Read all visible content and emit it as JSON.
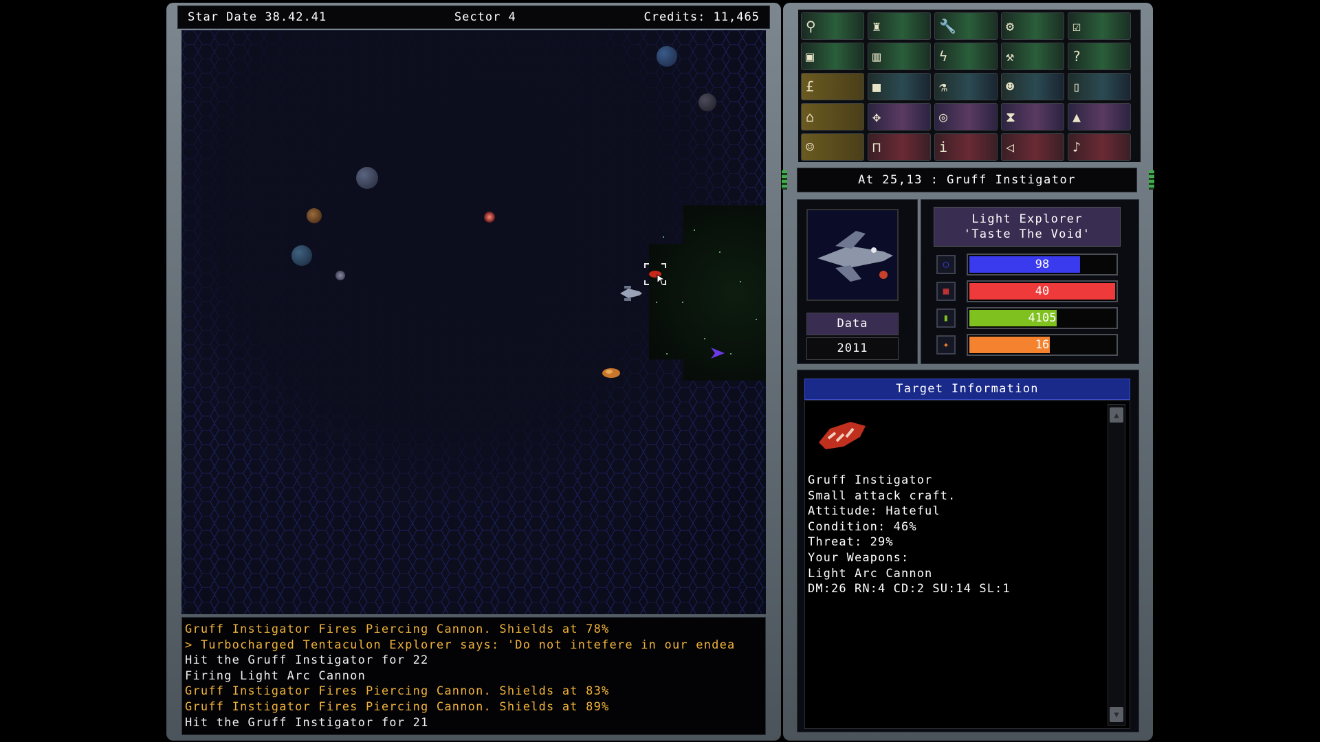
{
  "topbar": {
    "stardate": "Star Date 38.42.41",
    "sector": "Sector 4",
    "credits": "Credits: 11,465"
  },
  "log": {
    "lines": [
      {
        "text": "Gruff Instigator Fires Piercing Cannon. Shields at 78%",
        "color": "orange"
      },
      {
        "text": "> Turbocharged Tentaculon Explorer says: 'Do not intefere in our endea",
        "color": "orange"
      },
      {
        "text": "Hit the Gruff Instigator for 22",
        "color": "white"
      },
      {
        "text": "Firing Light Arc Cannon",
        "color": "white"
      },
      {
        "text": "Gruff Instigator Fires Piercing Cannon. Shields at 83%",
        "color": "orange"
      },
      {
        "text": "Gruff Instigator Fires Piercing Cannon. Shields at 89%",
        "color": "orange"
      },
      {
        "text": "Hit the Gruff Instigator for 21",
        "color": "white"
      }
    ]
  },
  "buttons": [
    {
      "icon": "crew-icon",
      "glyph": "⚲"
    },
    {
      "icon": "officer-icon",
      "glyph": "♜"
    },
    {
      "icon": "wrench-icon",
      "glyph": "🔧"
    },
    {
      "icon": "gear-icon",
      "glyph": "⚙"
    },
    {
      "icon": "checklist-icon",
      "glyph": "☑"
    },
    {
      "icon": "cargo-icon",
      "glyph": "▣"
    },
    {
      "icon": "chart-icon",
      "glyph": "▥"
    },
    {
      "icon": "lightning-icon",
      "glyph": "ϟ"
    },
    {
      "icon": "tools-icon",
      "glyph": "⚒"
    },
    {
      "icon": "help-icon",
      "glyph": "?"
    },
    {
      "icon": "trade-icon",
      "glyph": "£"
    },
    {
      "icon": "crate-icon",
      "glyph": "■"
    },
    {
      "icon": "flask-icon",
      "glyph": "⚗"
    },
    {
      "icon": "alien-icon",
      "glyph": "☻"
    },
    {
      "icon": "datapad-icon",
      "glyph": "▯"
    },
    {
      "icon": "station-icon",
      "glyph": "⌂"
    },
    {
      "icon": "navigation-icon",
      "glyph": "✥"
    },
    {
      "icon": "target-icon",
      "glyph": "◎"
    },
    {
      "icon": "hourglass-icon",
      "glyph": "⧗"
    },
    {
      "icon": "ship-icon",
      "glyph": "▲"
    },
    {
      "icon": "crew-group-icon",
      "glyph": "☺"
    },
    {
      "icon": "lock-icon",
      "glyph": "⊓"
    },
    {
      "icon": "info-icon",
      "glyph": "i"
    },
    {
      "icon": "sound-icon",
      "glyph": "◁"
    },
    {
      "icon": "music-icon",
      "glyph": "♪"
    }
  ],
  "status": {
    "location": "At 25,13 : Gruff Instigator"
  },
  "ship": {
    "class": "Light Explorer",
    "name": "'Taste The Void'",
    "data_label": "Data",
    "data_value": "2011",
    "stats": [
      {
        "icon": "shield-icon",
        "value": "98",
        "fraction": 0.76,
        "color": "#3a3aee"
      },
      {
        "icon": "hull-icon",
        "value": "40",
        "fraction": 1.0,
        "color": "#ee3a3a"
      },
      {
        "icon": "fuel-icon",
        "value": "4105",
        "fraction": 0.6,
        "color": "#7fc21f"
      },
      {
        "icon": "energy-icon",
        "value": "16",
        "fraction": 0.55,
        "color": "#f5822e"
      }
    ]
  },
  "target": {
    "header": "Target Information",
    "lines": [
      "Gruff Instigator",
      "Small attack craft.",
      "Attitude: Hateful",
      "Condition: 46%",
      "Threat: 29%",
      "Your Weapons:",
      "Light Arc Cannon",
      "DM:26 RN:4 CD:2 SU:14 SL:1"
    ],
    "scroll_up": "▲",
    "scroll_down": "▼"
  }
}
